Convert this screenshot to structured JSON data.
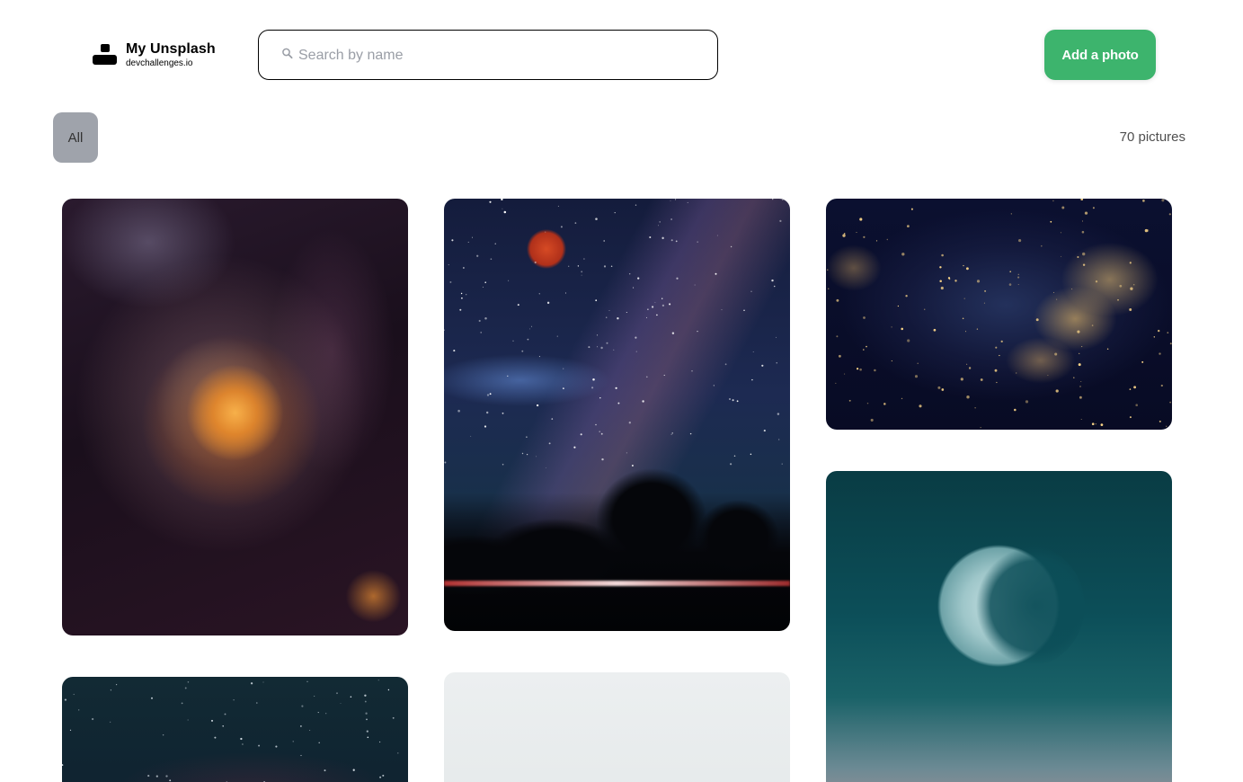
{
  "header": {
    "logo_title": "My Unsplash",
    "logo_subtitle": "devchallenges.io",
    "search_placeholder": "Search by name",
    "add_button_label": "Add a photo"
  },
  "filters": {
    "active_label": "All",
    "count_text": "70 pictures"
  },
  "colors": {
    "accent": "#3db46d",
    "filter_active_bg": "#9fa3ab"
  },
  "icons": {
    "search": "search-icon",
    "logo": "logo-icon"
  },
  "gallery": [
    {
      "subject": "fluid art"
    },
    {
      "subject": "night sky with red moon"
    },
    {
      "subject": "usa at night"
    },
    {
      "subject": "moon"
    },
    {
      "subject": "starry sky"
    },
    {
      "subject": "pale sky"
    }
  ]
}
